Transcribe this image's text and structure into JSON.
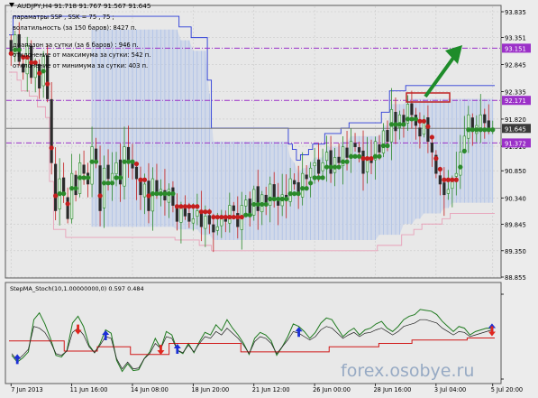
{
  "main_panel": {
    "title": "AUDJPY,H4  91.718 91.767 91.567 91.645",
    "info_lines": [
      "парамaтры SSP , SSK =  75 ,  75 ;",
      "волатильность  (за 150 баров):   8427  п.",
      "диапазон за сутки  (за  6  баров) :   946  п.",
      "отклонение от максимума за сутки:  542  п.",
      "отклонение от минимума  за сутки:  403  п."
    ]
  },
  "sub_panel": {
    "title": "StepMA_Stoch(10,1.00000000,0) 0.597 0.484"
  },
  "watermark": "forex.osobye.ru",
  "colors": {
    "bull": "#2a8a2a",
    "bear": "#c41e1e",
    "up_arrow": "#1b2fd6",
    "down_arrow": "#e0261e",
    "level": "#9b30c8",
    "current_price": "#7a7a7a",
    "cloud": "#b6c8ea",
    "upper_envelope": "#2a3bd8",
    "lower_envelope": "#e7a0b8",
    "big_arrow": "#1e8c2a",
    "highlight_box": "#c02424"
  },
  "chart_data": [
    {
      "type": "candlestick",
      "title": "AUDJPY,H4  91.718 91.767 91.567 91.645",
      "symbol": "AUDJPY",
      "timeframe": "H4",
      "ohlc_last": {
        "open": 91.718,
        "high": 91.767,
        "low": 91.567,
        "close": 91.645
      },
      "ylim": [
        88.855,
        93.835
      ],
      "y_ticks": [
        93.835,
        93.351,
        92.845,
        92.335,
        91.82,
        91.31,
        90.85,
        90.34,
        89.845,
        89.35,
        88.855
      ],
      "y_tick_labels": [
        "93.835",
        "93.351",
        "92.845",
        "92.335",
        "91.820",
        "91.310",
        "90.850",
        "90.340",
        "89.845",
        "89.350",
        "88.855"
      ],
      "x_tick_labels": [
        "7 Jun 2013",
        "11 Jun 16:00",
        "14 Jun 08:00",
        "18 Jun 20:00",
        "21 Jun 12:00",
        "26 Jun 00:00",
        "28 Jun 16:00",
        "3 Jul 04:00",
        "5 Jul 20:00"
      ],
      "levels": [
        {
          "value": 93.151,
          "label": "93.151",
          "style": "dash-dot",
          "color": "#9b30c8"
        },
        {
          "value": 92.171,
          "label": "92.171",
          "style": "dash-dot",
          "color": "#9b30c8"
        },
        {
          "value": 91.372,
          "label": "91.372",
          "style": "dash-dot",
          "color": "#9b30c8"
        },
        {
          "value": 91.645,
          "label": "91.645",
          "style": "solid",
          "color": "#7a7a7a"
        }
      ],
      "closes": [
        93.05,
        93.4,
        92.9,
        92.7,
        93.2,
        92.6,
        92.9,
        92.4,
        93.0,
        92.2,
        91.0,
        90.1,
        90.7,
        90.4,
        89.95,
        90.8,
        90.4,
        91.0,
        90.8,
        90.6,
        91.3,
        91.0,
        90.1,
        90.9,
        90.7,
        90.8,
        91.0,
        90.6,
        91.3,
        91.0,
        90.9,
        90.7,
        90.4,
        90.6,
        90.1,
        90.7,
        90.4,
        90.5,
        90.3,
        90.5,
        90.2,
        89.9,
        90.2,
        90.0,
        89.9,
        89.95,
        90.1,
        89.8,
        90.0,
        89.85,
        89.7,
        89.8,
        90.0,
        89.9,
        90.2,
        90.1,
        89.8,
        90.2,
        90.3,
        90.0,
        90.5,
        90.1,
        90.4,
        90.2,
        90.6,
        90.3,
        90.2,
        90.4,
        90.3,
        90.7,
        90.6,
        90.4,
        90.8,
        90.7,
        90.9,
        91.0,
        90.8,
        91.0,
        91.2,
        90.8,
        91.1,
        91.0,
        91.3,
        91.1,
        91.4,
        91.3,
        91.2,
        90.8,
        91.1,
        91.0,
        91.4,
        91.2,
        91.6,
        91.4,
        92.0,
        91.6,
        91.9,
        91.7,
        92.1,
        91.9,
        91.7,
        91.5,
        91.8,
        91.4,
        91.2,
        90.8,
        90.6,
        90.4,
        90.5,
        90.7,
        90.8,
        91.2,
        91.5,
        91.9,
        91.6,
        91.7,
        91.9,
        91.75,
        91.6,
        91.645
      ],
      "stepma_trend": "green above rising price, red below falling price"
    },
    {
      "type": "line",
      "title": "StepMA_Stoch(10,1.00000000,0) 0.597 0.484",
      "y_ticks": [
        1.0,
        0.0
      ],
      "series": [
        {
          "color": "green",
          "values": [
            0.28,
            0.2,
            0.25,
            0.32,
            0.7,
            0.78,
            0.65,
            0.48,
            0.28,
            0.26,
            0.34,
            0.66,
            0.74,
            0.62,
            0.4,
            0.31,
            0.42,
            0.58,
            0.54,
            0.22,
            0.09,
            0.18,
            0.1,
            0.11,
            0.24,
            0.32,
            0.48,
            0.36,
            0.56,
            0.52,
            0.34,
            0.3,
            0.42,
            0.31,
            0.44,
            0.55,
            0.52,
            0.64,
            0.57,
            0.7,
            0.6,
            0.52,
            0.42,
            0.29,
            0.48,
            0.55,
            0.52,
            0.45,
            0.28,
            0.38,
            0.5,
            0.65,
            0.62,
            0.56,
            0.48,
            0.55,
            0.66,
            0.72,
            0.7,
            0.6,
            0.5,
            0.56,
            0.6,
            0.52,
            0.58,
            0.6,
            0.65,
            0.68,
            0.6,
            0.56,
            0.62,
            0.7,
            0.74,
            0.76,
            0.82,
            0.81,
            0.8,
            0.76,
            0.68,
            0.62,
            0.56,
            0.62,
            0.6,
            0.52,
            0.56,
            0.58,
            0.6,
            0.597
          ]
        },
        {
          "color": "red",
          "values": [
            0.45,
            0.45,
            0.45,
            0.45,
            0.45,
            0.45,
            0.45,
            0.45,
            0.45,
            0.45,
            0.33,
            0.33,
            0.33,
            0.33,
            0.33,
            0.33,
            0.38,
            0.38,
            0.38,
            0.38,
            0.38,
            0.38,
            0.29,
            0.29,
            0.29,
            0.29,
            0.29,
            0.29,
            0.29,
            0.42,
            0.42,
            0.42,
            0.42,
            0.42,
            0.42,
            0.42,
            0.42,
            0.42,
            0.42,
            0.42,
            0.42,
            0.42,
            0.32,
            0.32,
            0.32,
            0.32,
            0.32,
            0.32,
            0.32,
            0.32,
            0.32,
            0.32,
            0.32,
            0.32,
            0.32,
            0.32,
            0.32,
            0.32,
            0.38,
            0.38,
            0.38,
            0.38,
            0.38,
            0.38,
            0.38,
            0.38,
            0.38,
            0.42,
            0.42,
            0.42,
            0.42,
            0.42,
            0.42,
            0.46,
            0.46,
            0.46,
            0.46,
            0.46,
            0.46,
            0.46,
            0.46,
            0.46,
            0.46,
            0.484,
            0.484,
            0.484,
            0.484,
            0.484
          ]
        },
        {
          "color": "black",
          "values": [
            0.3,
            0.22,
            0.28,
            0.35,
            0.62,
            0.6,
            0.55,
            0.44,
            0.3,
            0.28,
            0.33,
            0.55,
            0.6,
            0.52,
            0.38,
            0.31,
            0.4,
            0.5,
            0.48,
            0.24,
            0.12,
            0.2,
            0.12,
            0.13,
            0.24,
            0.3,
            0.42,
            0.36,
            0.5,
            0.48,
            0.34,
            0.31,
            0.4,
            0.32,
            0.42,
            0.5,
            0.48,
            0.56,
            0.52,
            0.6,
            0.54,
            0.48,
            0.4,
            0.3,
            0.44,
            0.5,
            0.48,
            0.42,
            0.3,
            0.38,
            0.46,
            0.56,
            0.54,
            0.5,
            0.46,
            0.5,
            0.58,
            0.62,
            0.6,
            0.54,
            0.48,
            0.52,
            0.55,
            0.5,
            0.54,
            0.55,
            0.58,
            0.6,
            0.56,
            0.52,
            0.56,
            0.62,
            0.64,
            0.66,
            0.7,
            0.7,
            0.68,
            0.66,
            0.6,
            0.56,
            0.52,
            0.56,
            0.55,
            0.5,
            0.52,
            0.54,
            0.56,
            0.58
          ]
        }
      ],
      "signals_up_idx": [
        1,
        17,
        30,
        52,
        102,
        113
      ],
      "signals_down_idx": [
        12,
        27,
        98
      ]
    }
  ]
}
